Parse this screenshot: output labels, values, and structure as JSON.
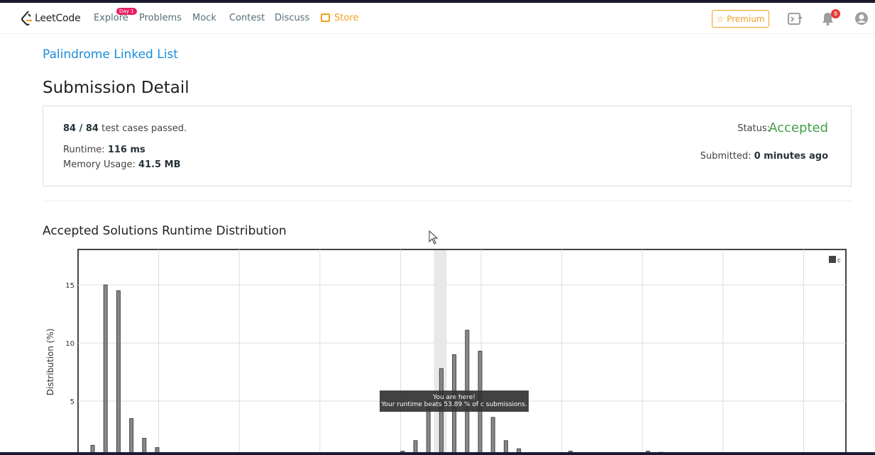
{
  "nav": {
    "logo_text": "LeetCode",
    "explore": "Explore",
    "explore_badge": "Day 1",
    "problems": "Problems",
    "mock": "Mock",
    "contest": "Contest",
    "discuss": "Discuss",
    "store": "Store",
    "premium": "☆ Premium",
    "notifications_count": "8"
  },
  "problem_title": "Palindrome Linked List",
  "page_title": "Submission Detail",
  "detail": {
    "passed": "84 / 84",
    "passed_suffix": " test cases passed.",
    "runtime_label": "Runtime: ",
    "runtime_value": "116 ms",
    "memory_label": "Memory Usage: ",
    "memory_value": "41.5 MB",
    "status_label": "Status:",
    "status_value": "Accepted",
    "submitted_label": "Submitted: ",
    "submitted_value": "0 minutes ago"
  },
  "section_title": "Accepted Solutions Runtime Distribution",
  "tooltip": {
    "line1": "You are here!",
    "line2": "Your runtime beats 53.89 % of c submissions."
  },
  "chart_data": {
    "type": "bar",
    "ylabel": "Distribution (%)",
    "yticks": [
      "5",
      "10",
      "15"
    ],
    "ylim": [
      0,
      18
    ],
    "legend": [
      "c"
    ],
    "legend_position": "top-right",
    "grid": true,
    "highlight_index": 27,
    "values": [
      1.2,
      15.0,
      14.5,
      3.5,
      1.8,
      1.0,
      0.2,
      0.1,
      0.1,
      0.1,
      0.1,
      0.1,
      0.1,
      0.1,
      0.1,
      0.1,
      0.1,
      0.1,
      0.1,
      0.1,
      0.1,
      0.1,
      0.1,
      0.1,
      0.7,
      1.6,
      5.0,
      7.8,
      9.0,
      11.1,
      9.3,
      3.6,
      1.6,
      0.9,
      0.2,
      0.1,
      0.1,
      0.7,
      0.1,
      0.1,
      0.1,
      0.1,
      0.1,
      0.7,
      0.6
    ]
  }
}
